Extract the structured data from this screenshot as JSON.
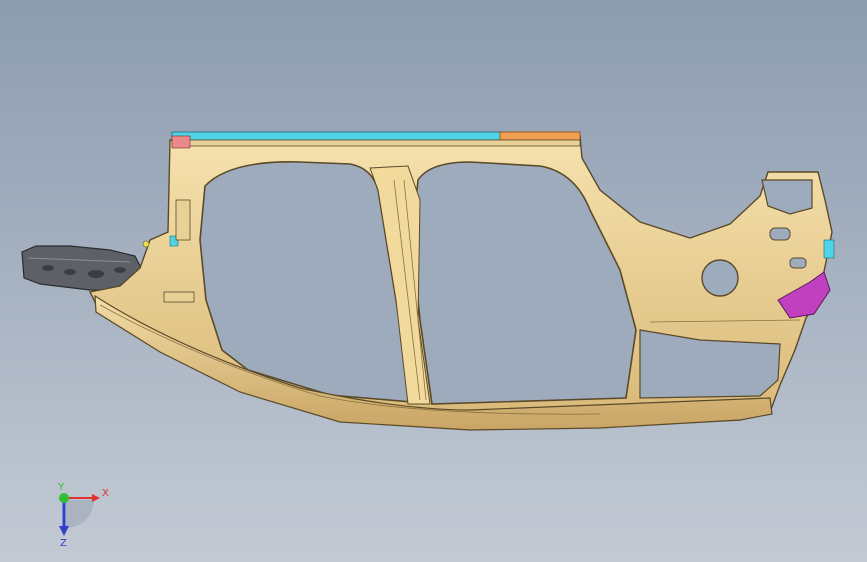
{
  "viewport": {
    "background_top": "#8d9cb0",
    "background_bottom": "#c3cad4"
  },
  "model": {
    "part_color": "#f0d9a0",
    "edge_color": "#5a4a2a",
    "highlight_cyan": "#4fd3e6",
    "highlight_orange": "#f0a050",
    "highlight_magenta": "#c040c0",
    "dark_part_color": "#6a6e74"
  },
  "triad": {
    "x_label": "X",
    "y_label": "Y",
    "z_label": "Z",
    "x_color": "#e03030",
    "y_color": "#30c030",
    "z_color": "#3040d0"
  }
}
